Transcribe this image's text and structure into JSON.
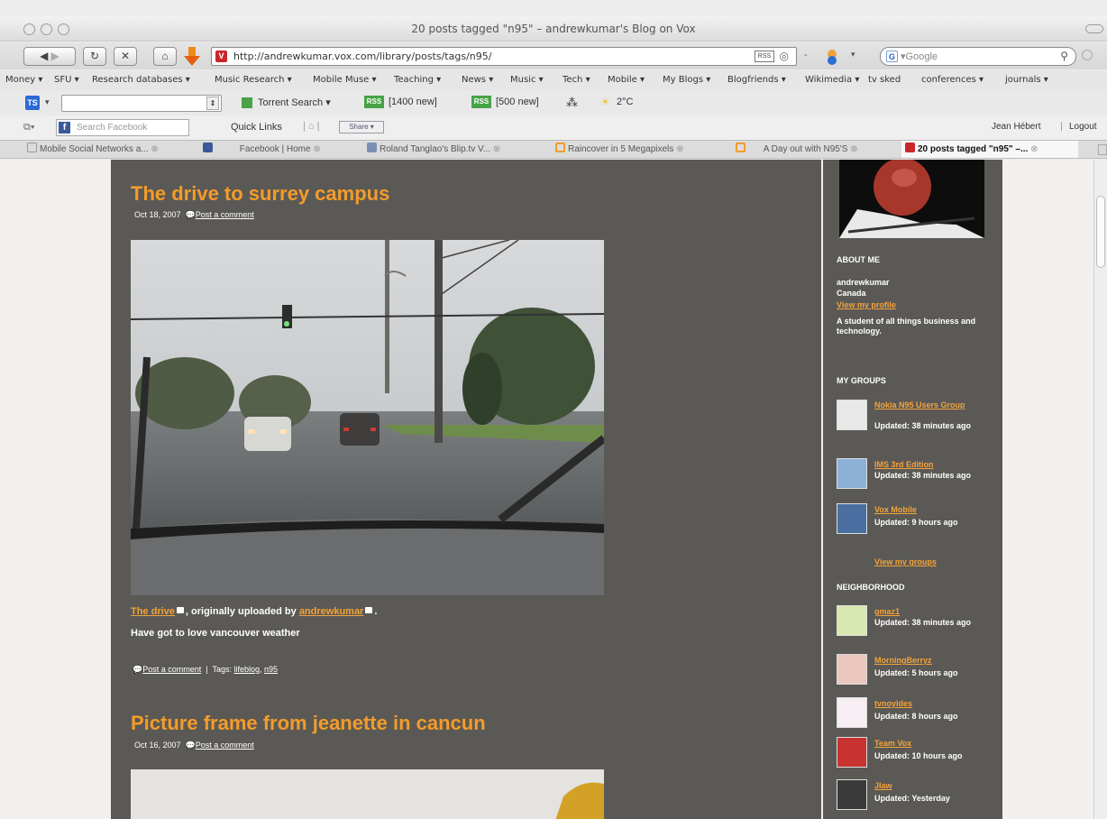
{
  "window": {
    "title": "20 posts tagged \"n95\" – andrewkumar's Blog on Vox"
  },
  "navbar": {
    "url": "http://andrewkumar.vox.com/library/posts/tags/n95/",
    "search_placeholder": "Google"
  },
  "bookmarks": [
    "Money ▾",
    "SFU ▾",
    "Research databases ▾",
    "Music Research ▾",
    "Mobile Muse ▾",
    "Teaching ▾",
    "News ▾",
    "Music ▾",
    "Tech ▾",
    "Mobile ▾",
    "My Blogs ▾",
    "Blogfriends ▾",
    "Wikimedia ▾",
    "tv sked",
    "conferences ▾",
    "journals ▾"
  ],
  "toolbar3": {
    "torrent_search": "Torrent Search ▾",
    "rss1": "[1400 new]",
    "rss2": "[500 new]",
    "temperature": "2°C"
  },
  "fbbar": {
    "search_placeholder": "Search Facebook",
    "quick_links": "Quick Links",
    "share": "Share ▾",
    "user": "Jean Hébert",
    "logout": "Logout"
  },
  "tabs": [
    {
      "label": "Mobile Social Networks a...",
      "active": false
    },
    {
      "label": "Facebook | Home",
      "active": false
    },
    {
      "label": "Roland Tanglao's Blip.tv V...",
      "active": false
    },
    {
      "label": "Raincover in 5 Megapixels",
      "active": false
    },
    {
      "label": "A Day out with N95'S",
      "active": false
    },
    {
      "label": "20 posts tagged \"n95\" –...",
      "active": true
    }
  ],
  "posts": [
    {
      "title": "The drive to surrey campus",
      "date": "Oct 18, 2007",
      "comment_link": "Post a comment",
      "caption_link": "The drive",
      "caption_mid": ", originally uploaded by ",
      "caption_author": "andrewkumar",
      "caption_end": ".",
      "body": "Have got to love vancouver weather",
      "footer_comment": "Post a comment",
      "tags_label": "Tags:",
      "tag1": "lifeblog",
      "tag2": "n95"
    },
    {
      "title": "Picture frame from jeanette in cancun",
      "date": "Oct 16, 2007",
      "comment_link": "Post a comment"
    }
  ],
  "sidebar": {
    "about_heading": "ABOUT ME",
    "name": "andrewkumar",
    "country": "Canada",
    "profile_link": "View my profile",
    "bio": "A student of all things business and technology.",
    "groups_heading": "MY GROUPS",
    "groups": [
      {
        "name": "Nokia N95 Users Group",
        "updated": "Updated: 38 minutes ago"
      },
      {
        "name": "IMS 3rd Edition",
        "updated": "Updated: 38 minutes ago"
      },
      {
        "name": "Vox Mobile",
        "updated": "Updated: 9 hours ago"
      }
    ],
    "view_groups": "View my groups",
    "neighborhood_heading": "NEIGHBORHOOD",
    "neighbors": [
      {
        "name": "gmaz1",
        "updated": "Updated: 38 minutes ago"
      },
      {
        "name": "MorningBerryz",
        "updated": "Updated: 5 hours ago"
      },
      {
        "name": "tvnoyides",
        "updated": "Updated: 8 hours ago"
      },
      {
        "name": "Team Vox",
        "updated": "Updated: 10 hours ago"
      },
      {
        "name": "Jlaw",
        "updated": "Updated: Yesterday"
      }
    ]
  }
}
